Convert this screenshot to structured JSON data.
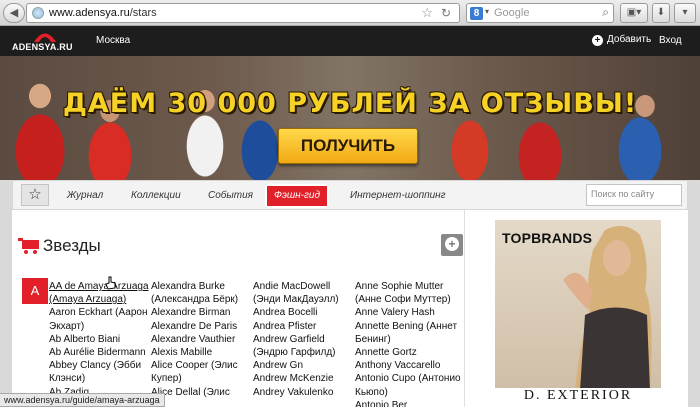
{
  "browser": {
    "url_host": "www.adensya.ru",
    "url_path": "/stars",
    "search_engine": "Google",
    "search_placeholder": "Google",
    "status_url": "www.adensya.ru/guide/amaya-arzuaga"
  },
  "header": {
    "logo_text": "ADENSYA.RU",
    "city": "Москва",
    "add_label": "Добавить",
    "login_label": "Вход"
  },
  "banner": {
    "headline": "ДАЁМ 30 000 РУБЛЕЙ ЗА ОТЗЫВЫ!",
    "cta": "ПОЛУЧИТЬ"
  },
  "nav": {
    "items": [
      "Журнал",
      "Коллекции",
      "События",
      "Фэшн-гид",
      "Интернет-шоппинг"
    ],
    "active_index": 3,
    "search_placeholder": "Поиск по сайту"
  },
  "page": {
    "title": "Звезды",
    "letter": "А",
    "columns": [
      [
        "AA de Amaya Arzuaga (Amaya Arzuaga)",
        "Aaron Eckhart (Аарон Экхарт)",
        "Ab Alberto Biani",
        "Ab Aurélie Bidermann",
        "Abbey Clancy (Эбби Клэнси)",
        "Ab Zadig"
      ],
      [
        "Alexandra Burke (Александра Бёрк)",
        "Alexandre Birman",
        "Alexandre De Paris",
        "Alexandre Vauthier",
        "Alexis Mabille",
        "Alice Cooper (Элис Купер)",
        "Alice Dellal (Элис"
      ],
      [
        "Andie MacDowell (Энди МакДауэлл)",
        "Andrea Bocelli",
        "Andrea Pfister",
        "Andrew Garfield (Эндрю Гарфилд)",
        "Andrew Gn",
        "Andrew McKenzie",
        "Andrey Vakulenko"
      ],
      [
        "Anne Sophie Mutter (Анне Софи Муттер)",
        "Anne Valery Hash",
        "Annette Bening (Аннет Бенинг)",
        "Annette Gortz",
        "Anthony Vaccarello",
        "Antonio Cupo (Антонио Кьюпо)",
        "Antonio Ber"
      ]
    ]
  },
  "ad": {
    "brand": "TOPBRANDS",
    "footer": "D. EXTERIOR"
  },
  "colors": {
    "accent_red": "#e2202a",
    "topbar": "#1d1d1d",
    "banner_yellow": "#f7d226"
  }
}
